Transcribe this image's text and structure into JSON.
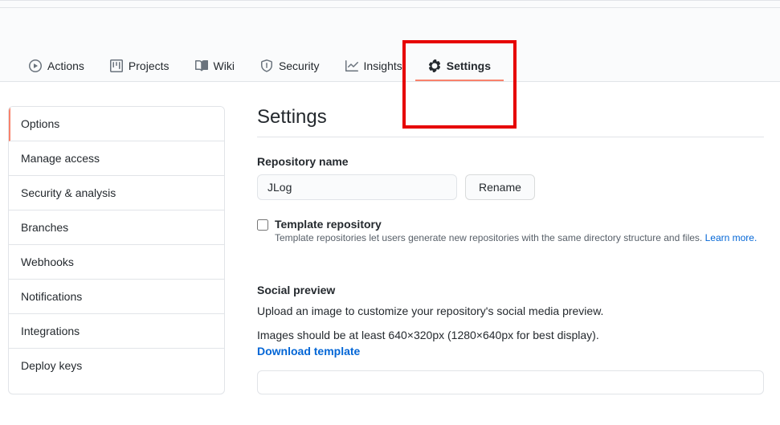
{
  "tabs": {
    "actions": "Actions",
    "projects": "Projects",
    "wiki": "Wiki",
    "security": "Security",
    "insights": "Insights",
    "settings": "Settings"
  },
  "sidebar": {
    "options": "Options",
    "manage_access": "Manage access",
    "security_analysis": "Security & analysis",
    "branches": "Branches",
    "webhooks": "Webhooks",
    "notifications": "Notifications",
    "integrations": "Integrations",
    "deploy_keys": "Deploy keys"
  },
  "main": {
    "heading": "Settings",
    "repo_name_label": "Repository name",
    "repo_name_value": "JLog",
    "rename_button": "Rename",
    "template_label": "Template repository",
    "template_desc": "Template repositories let users generate new repositories with the same directory structure and files. ",
    "template_link": "Learn more.",
    "social_title": "Social preview",
    "social_para1": "Upload an image to customize your repository's social media preview.",
    "social_para2": "Images should be at least 640×320px (1280×640px for best display).",
    "download_template": "Download template"
  }
}
